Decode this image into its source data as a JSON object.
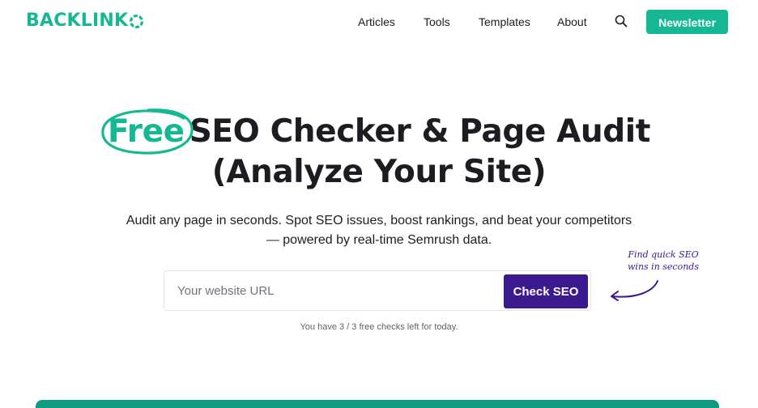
{
  "header": {
    "logo_text": "BACKLINK",
    "nav": [
      {
        "label": "Articles"
      },
      {
        "label": "Tools"
      },
      {
        "label": "Templates"
      },
      {
        "label": "About"
      }
    ],
    "search_icon": "search-icon",
    "newsletter_label": "Newsletter"
  },
  "hero": {
    "title_highlight": "Free",
    "title_line1_rest": "SEO Checker & Page Audit",
    "title_line2": "(Analyze Your Site)",
    "subtitle_line1": "Audit any page in seconds. Spot SEO issues, boost rankings, and beat your competitors",
    "subtitle_line2": "— powered by real-time Semrush data."
  },
  "form": {
    "url_placeholder": "Your website URL",
    "submit_label": "Check SEO",
    "checks_left_text": "You have 3 / 3 free checks left for today."
  },
  "annotation": {
    "line1": "Find quick SEO",
    "line2": "wins in seconds"
  },
  "colors": {
    "brand": "#16b893",
    "cta": "#3b1a8f",
    "text": "#1b1d21"
  }
}
